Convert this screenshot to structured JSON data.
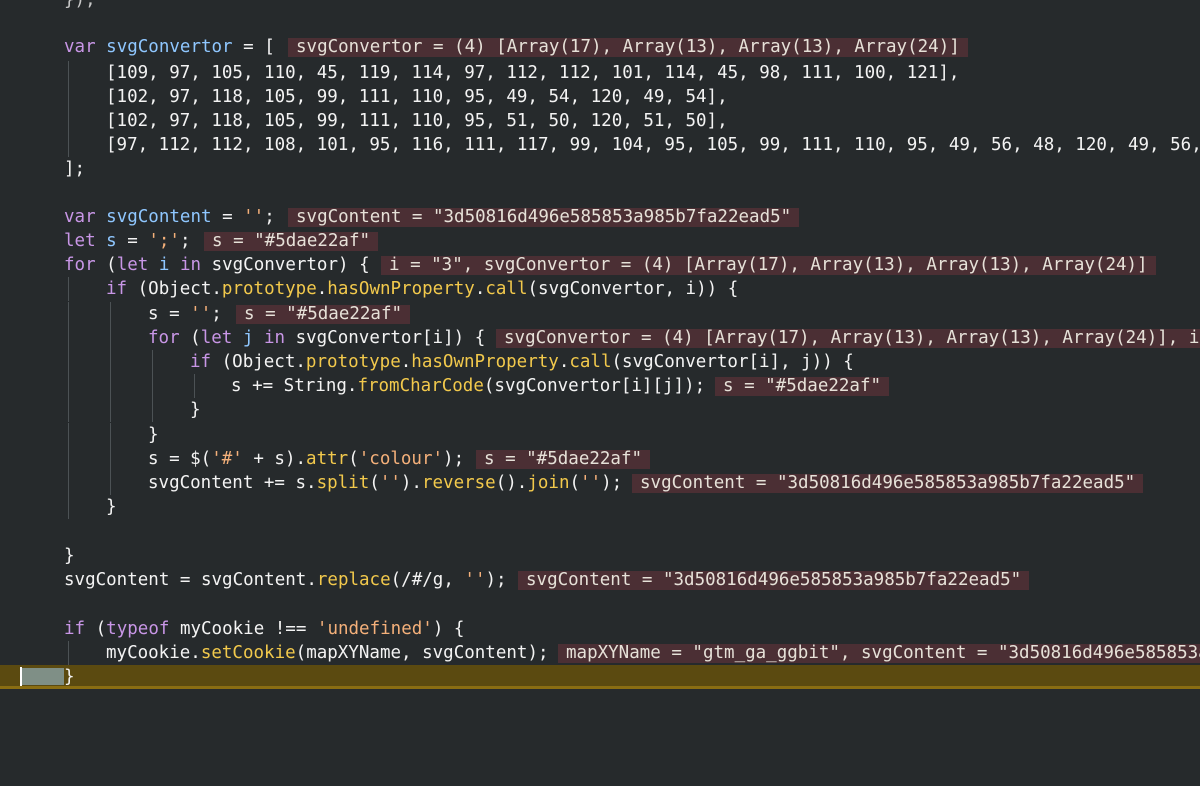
{
  "lines": [
    {
      "text": "var svgConvertor = [",
      "hint": "svgConvertor = (4) [Array(17), Array(13), Array(13), Array(24)]"
    },
    {
      "text": "[109, 97, 105, 110, 45, 119, 114, 97, 112, 112, 101, 114, 45, 98, 111, 100, 121],"
    },
    {
      "text": "[102, 97, 118, 105, 99, 111, 110, 95, 49, 54, 120, 49, 54],"
    },
    {
      "text": "[102, 97, 118, 105, 99, 111, 110, 95, 51, 50, 120, 51, 50],"
    },
    {
      "text": "[97, 112, 112, 108, 101, 95, 116, 111, 117, 99, 104, 95, 105, 99, 111, 110, 95, 49, 56, 48, 120, 49, 56,"
    },
    {
      "text": "];"
    },
    {
      "text": "var svgContent = '';",
      "hint": "svgContent = \"3d50816d496e585853a985b7fa22ead5\""
    },
    {
      "text": "let s = ';';",
      "hint": "s = \"#5dae22af\""
    },
    {
      "text": "for (let i in svgConvertor) {",
      "hint": "i = \"3\", svgConvertor = (4) [Array(17), Array(13), Array(13), Array(24)]"
    },
    {
      "text": "if (Object.prototype.hasOwnProperty.call(svgConvertor, i)) {"
    },
    {
      "text": "s = '';",
      "hint": "s = \"#5dae22af\""
    },
    {
      "text": "for (let j in svgConvertor[i]) {",
      "hint": "svgConvertor = (4) [Array(17), Array(13), Array(13), Array(24)], i"
    },
    {
      "text": "if (Object.prototype.hasOwnProperty.call(svgConvertor[i], j)) {"
    },
    {
      "text": "s += String.fromCharCode(svgConvertor[i][j]);",
      "hint": "s = \"#5dae22af\""
    },
    {
      "text": "}"
    },
    {
      "text": "}"
    },
    {
      "text": "s = $('#' + s).attr('colour');",
      "hint": "s = \"#5dae22af\""
    },
    {
      "text": "svgContent += s.split('').reverse().join('');",
      "hint": "svgContent = \"3d50816d496e585853a985b7fa22ead5\""
    },
    {
      "text": "}"
    },
    {
      "text": "}"
    },
    {
      "text": "svgContent = svgContent.replace(/#/g, '');",
      "hint": "svgContent = \"3d50816d496e585853a985b7fa22ead5\""
    },
    {
      "text": "if (typeof myCookie !== 'undefined') {"
    },
    {
      "text": "myCookie.setCookie(mapXYName, svgContent);",
      "hint": "mapXYName = \"gtm_ga_ggbit\", svgContent = \"3d50816d496e585853a"
    },
    {
      "text": "}"
    }
  ],
  "top_fragment": "});"
}
